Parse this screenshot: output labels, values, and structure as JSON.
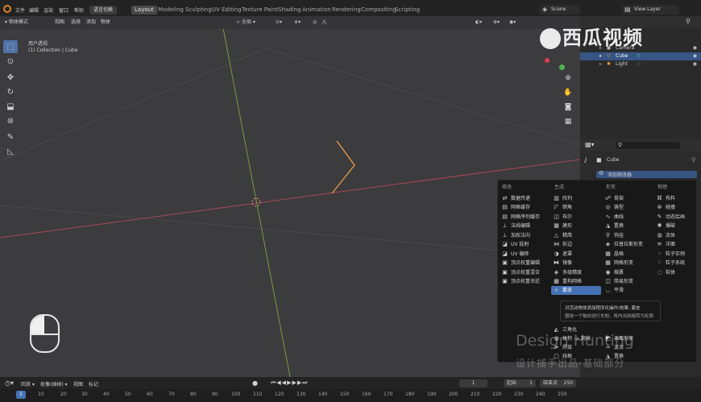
{
  "topbar": {
    "menus": [
      "文件",
      "编辑",
      "渲染",
      "窗口",
      "帮助"
    ],
    "lang_switch": "语言切换",
    "workspaces": [
      "Layout",
      "Modeling",
      "Sculpting",
      "UV Editing",
      "Texture Paint",
      "Shading",
      "Animation",
      "Rendering",
      "Compositing",
      "Scripting"
    ],
    "active_workspace": "Layout",
    "scene": "Scene",
    "view_layer": "View Layer"
  },
  "viewport_header": {
    "mode": "物体模式",
    "view": "视图",
    "select": "选择",
    "add": "添加",
    "object": "物体",
    "orientation": "全局"
  },
  "viewport": {
    "view_name": "用户透视",
    "collection_info": "(1) Collection | Cube"
  },
  "outliner": {
    "items": [
      {
        "name": "Camera",
        "selected": false
      },
      {
        "name": "Cube",
        "selected": true
      },
      {
        "name": "Light",
        "selected": false
      }
    ]
  },
  "properties": {
    "object_name": "Cube",
    "add_modifier": "添加修改器"
  },
  "modifier_menu": {
    "columns": [
      {
        "header": "修改",
        "items": [
          "数据传递",
          "网格缓存",
          "网格序列缓存",
          "法线编辑",
          "加权法向",
          "UV 投射",
          "UV 偏移",
          "顶点权重编辑",
          "顶点权重混合",
          "顶点权重邻近"
        ]
      },
      {
        "header": "生成",
        "items": [
          "阵列",
          "倒角",
          "布尔",
          "建形",
          "精简",
          "拆边",
          "遮罩",
          "镜像",
          "多级精度",
          "重构网格",
          "蒙皮",
          "",
          "",
          "",
          "三角化",
          "体积 -> 网格",
          "焊接",
          "线框"
        ]
      },
      {
        "header": "形变",
        "items": [
          "骨架",
          "铸型",
          "曲线",
          "置换",
          "钩挂",
          "拉普拉斯形变",
          "晶格",
          "网格形变",
          "缩裹",
          "简易形变",
          "平滑",
          "",
          "",
          "",
          "",
          "表面形变",
          "",
          "",
          "波浪",
          "置换"
        ]
      },
      {
        "header": "物理",
        "items": [
          "布料",
          "碰撞",
          "动态绘画",
          "爆破",
          "流体",
          "洋面",
          "粒子实例",
          "粒子系统",
          "软体"
        ]
      }
    ],
    "highlighted": "蒙皮"
  },
  "tooltip": {
    "line1": "对活动物体添加程序化操作/效果: 蒙皮",
    "line2": "围绕一个轴向进行车削，将内出网格转为轮廓"
  },
  "timeline": {
    "playback": "回放",
    "keying": "抠像(插帧)",
    "view": "视图",
    "marker": "标记",
    "current_frame": "1",
    "start_label": "起始",
    "start": "1",
    "end_label": "结束点",
    "end": "250",
    "ruler": [
      "1",
      "10",
      "20",
      "30",
      "40",
      "50",
      "60",
      "70",
      "80",
      "90",
      "100",
      "110",
      "120",
      "130",
      "140",
      "150",
      "160",
      "170",
      "180",
      "190",
      "200",
      "210",
      "220",
      "230",
      "240",
      "250"
    ]
  },
  "watermark": {
    "logo": "西瓜视频",
    "line1": "Design Hunting",
    "line2": "设计捕手出品-基础部分"
  },
  "colors": {
    "accent": "#4672b5",
    "x_axis": "#a84a55",
    "y_axis": "#7a9a3a",
    "selection": "#e8a040"
  }
}
